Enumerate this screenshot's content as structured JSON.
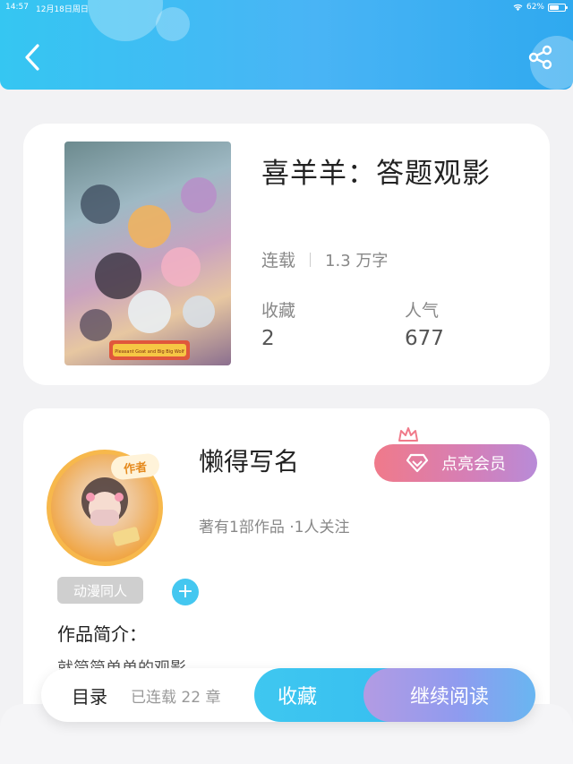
{
  "status_bar": {
    "time": "14:57",
    "date": "12月18日周日",
    "battery": "62%",
    "battery_level": 0.62
  },
  "book": {
    "title": "喜羊羊：答题观影",
    "status": "连载",
    "word_count": "1.3 万字",
    "favorites_label": "收藏",
    "favorites_value": "2",
    "popularity_label": "人气",
    "popularity_value": "677",
    "cover_logo": "Pleasant Goat and Big Big Wolf"
  },
  "author": {
    "tag": "作者",
    "name": "懒得写名",
    "vip_label": "点亮会员",
    "stats": "著有1部作品 ·1人关注",
    "genre": "动漫同人",
    "add_symbol": "+",
    "intro_label": "作品简介：",
    "intro_text": "就简简单单的观影"
  },
  "action_bar": {
    "toc_label": "目录",
    "chapters_label": "已连载 22 章",
    "favorite_label": "收藏",
    "read_label": "继续阅读"
  },
  "colors": {
    "accent": "#3fc7f0",
    "header": "#49b4f5",
    "vip": "#f07a8a"
  },
  "icons": [
    "back-icon",
    "share-icon",
    "wifi-icon",
    "battery-icon",
    "diamond-icon",
    "crown-icon",
    "plus-icon"
  ]
}
